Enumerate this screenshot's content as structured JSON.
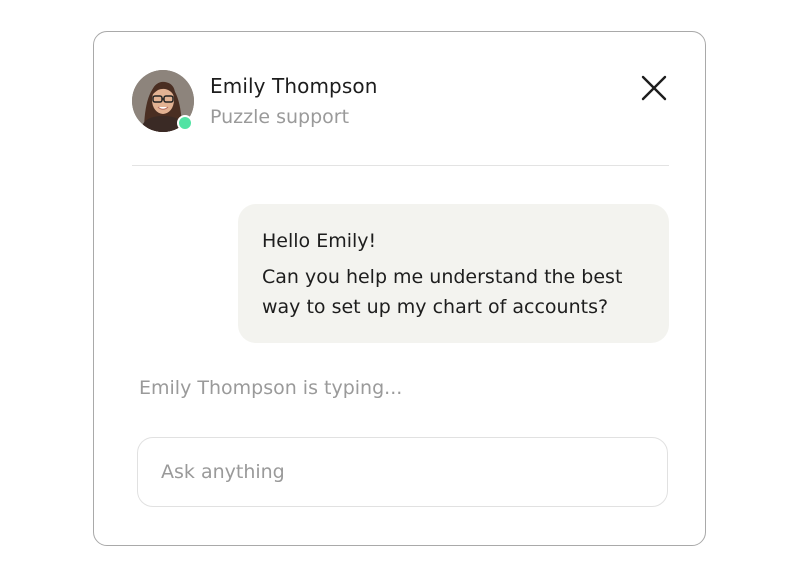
{
  "agent": {
    "name": "Emily Thompson",
    "role": "Puzzle support",
    "status": "online",
    "status_color": "#52e3a4"
  },
  "header": {
    "close_icon": "close-icon"
  },
  "messages": [
    {
      "from": "user",
      "lines": [
        "Hello Emily!",
        "Can you help me understand the best way to set up my chart of accounts?"
      ]
    }
  ],
  "typing_indicator": "Emily Thompson is typing...",
  "composer": {
    "placeholder": "Ask anything",
    "value": ""
  },
  "colors": {
    "bubble_background": "#f3f3ef",
    "border": "#a9a9a9",
    "muted_text": "#9a9a9a"
  }
}
